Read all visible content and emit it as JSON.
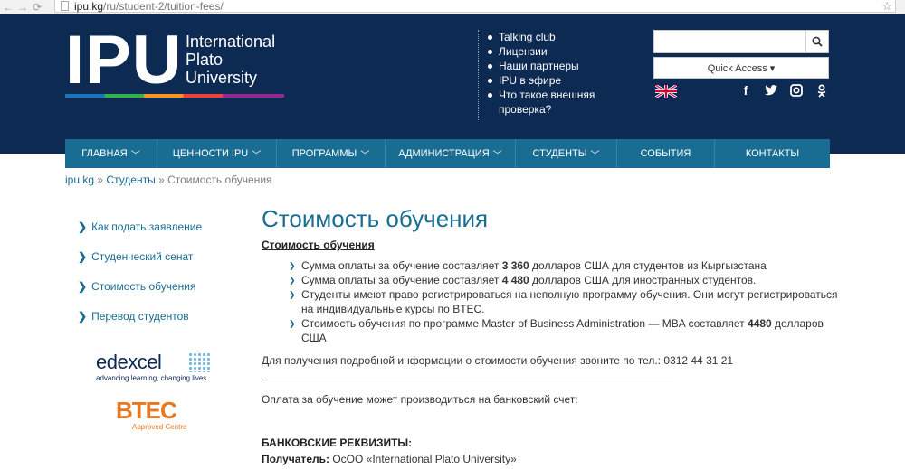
{
  "browser": {
    "url_host": "ipu.kg",
    "url_path": "/ru/student-2/tuition-fees/"
  },
  "header": {
    "logo_text": "IPU",
    "logo_name_lines": [
      "International",
      "Plato",
      "University"
    ],
    "top_links": [
      "Talking club",
      "Лицензии",
      "Наши партнеры",
      "IPU в эфире",
      "Что такое внешняя",
      "проверка?"
    ],
    "search_placeholder": "",
    "quick_access_label": "Quick Access ▾"
  },
  "nav": [
    {
      "label": "ГЛАВНАЯ",
      "chevron": true
    },
    {
      "label": "ЦЕННОСТИ IPU",
      "chevron": true
    },
    {
      "label": "ПРОГРАММЫ",
      "chevron": true
    },
    {
      "label": "АДМИНИСТРАЦИЯ",
      "chevron": true
    },
    {
      "label": "СТУДЕНТЫ",
      "chevron": true
    },
    {
      "label": "СОБЫТИЯ",
      "chevron": false
    },
    {
      "label": "КОНТАКТЫ",
      "chevron": false
    }
  ],
  "breadcrumb": {
    "home": "ipu.kg",
    "sep": "»",
    "students": "Студенты",
    "current": "Стоимость обучения"
  },
  "sidebar": [
    "Как подать заявление",
    "Студенческий сенат",
    "Стоимость обучения",
    "Перевод студентов"
  ],
  "partners": {
    "edexcel": "edexcel",
    "edexcel_tag": "advancing learning, changing lives",
    "btec": "BTEC",
    "btec_tag": "Approved Centre"
  },
  "content": {
    "title": "Стоимость обучения",
    "subtitle": "Стоимость обучения",
    "bullets": [
      {
        "pre": "Сумма оплаты за обучение составляет ",
        "bold": "3 360",
        "post": " долларов США для студентов из Кыргызстана"
      },
      {
        "pre": "Сумма оплаты за обучение составляет  ",
        "bold": "4 480",
        "post": " долларов США для иностранных студентов."
      },
      {
        "pre": "Студенты имеют право регистрироваться на неполную программу обучения. Они могут регистрироваться на индивидуальные курсы по BTEC.",
        "bold": "",
        "post": ""
      },
      {
        "pre": "Стоимость обучения по программе Master of  Business Administration — MBA составляет ",
        "bold": "4480",
        "post": " долларов США"
      }
    ],
    "info": "Для получения подробной информации о стоимости обучения звоните по тел.: 0312 44 31 21",
    "payment": "Оплата за обучение может производиться на банковский счет:",
    "bank_heading": "БАНКОВСКИЕ РЕКВИЗИТЫ:",
    "recipient_label": "Получатель:",
    "recipient_value": " ОсОО «International Plato University»"
  },
  "colors": {
    "header_bg": "#0d2a52",
    "nav_bg": "#1a6d92",
    "link": "#1a6d92"
  }
}
